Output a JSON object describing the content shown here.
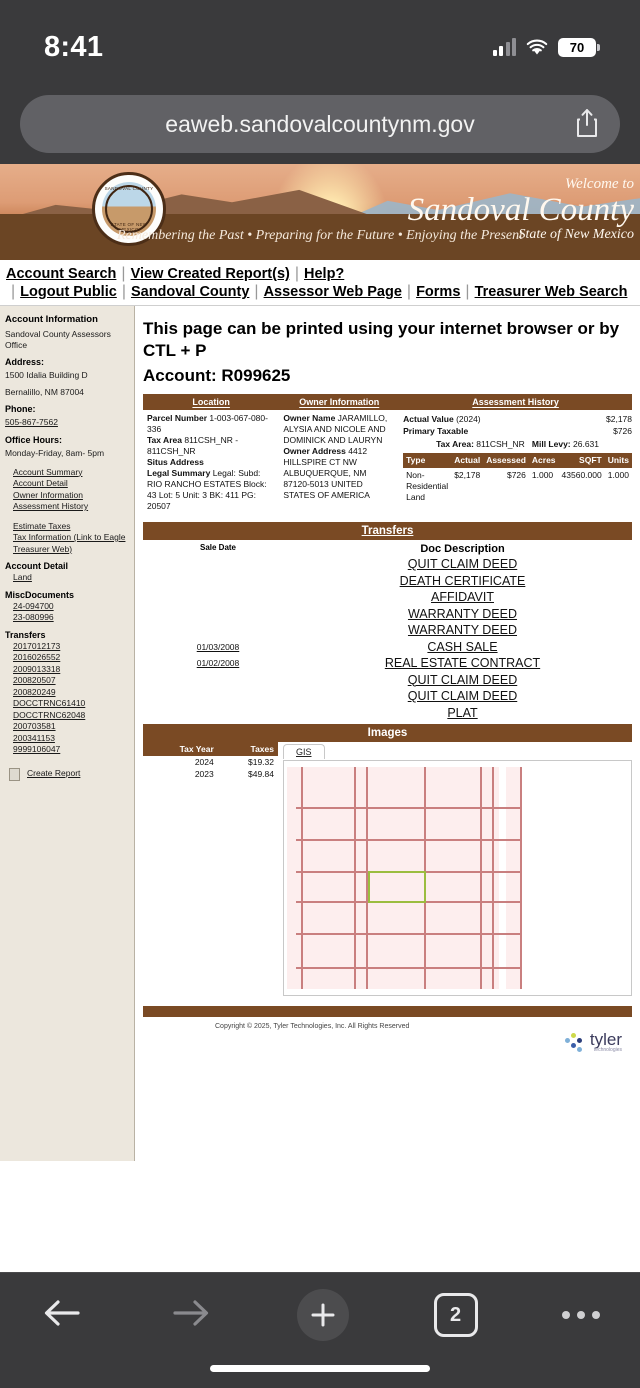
{
  "status_bar": {
    "time": "8:41",
    "battery": "70",
    "cell_icon": "cellular-signal-icon",
    "wifi_icon": "wifi-icon"
  },
  "browser": {
    "url": "eaweb.sandovalcountynm.gov",
    "share_icon": "share-icon",
    "back_icon": "back-arrow-icon",
    "forward_icon": "forward-arrow-icon",
    "new_tab_icon": "plus-icon",
    "tab_count": "2",
    "more_icon": "more-options-icon"
  },
  "banner": {
    "welcome": "Welcome to",
    "county": "Sandoval County",
    "state": "State of New Mexico",
    "motto": "Remembering the Past • Preparing for the Future • Enjoying the Present",
    "seal_top": "SANDOVAL COUNTY",
    "seal_bottom": "STATE OF NEW MEXICO"
  },
  "nav": [
    "Account Search",
    "View Created Report(s)",
    "Help?",
    "Logout Public",
    "Sandoval County",
    "Assessor Web Page",
    "Forms",
    "Treasurer Web Search"
  ],
  "sidebar": {
    "title": "Account Information",
    "office": "Sandoval County Assessors Office",
    "address_label": "Address:",
    "address_line1": "1500 Idalia Building D",
    "address_line2": "Bernalillo, NM 87004",
    "phone_label": "Phone:",
    "phone": "505-867-7562",
    "hours_label": "Office Hours:",
    "hours": "Monday-Friday, 8am- 5pm",
    "links": [
      "Account Summary",
      "Account Detail",
      "Owner Information",
      "Assessment History"
    ],
    "links2": [
      "Estimate Taxes",
      "Tax Information (Link to Eagle Treasurer Web)"
    ],
    "groups": [
      {
        "heading": "Account Detail",
        "items": [
          "Land"
        ]
      },
      {
        "heading": "MiscDocuments",
        "items": [
          "24-094700",
          "23-080996"
        ]
      },
      {
        "heading": "Transfers",
        "items": [
          "2017012173",
          "2016026552",
          "2009013318",
          "200820507",
          "200820249",
          "DOCCTRNC61410",
          "DOCCTRNC62048",
          "200703581",
          "200341153",
          "9999106047"
        ]
      }
    ],
    "create_report": "Create Report"
  },
  "main": {
    "print_notice": "This page can be printed using your internet browser or by CTL + P",
    "account_label": "Account: R099625",
    "columns": {
      "location": "Location",
      "owner": "Owner Information",
      "assessment": "Assessment History"
    },
    "location": {
      "parcel_number_label": "Parcel Number",
      "parcel_number": "1-003-067-080-336",
      "tax_area_label": "Tax Area",
      "tax_area": "811CSH_NR - 811CSH_NR",
      "situs_label": "Situs Address",
      "situs": "",
      "legal_label": "Legal Summary",
      "legal": "Legal: Subd: RIO RANCHO ESTATES Block: 43 Lot: 5 Unit: 3 BK: 411 PG: 20507"
    },
    "owner": {
      "name_label": "Owner Name",
      "name": "JARAMILLO, ALYSIA AND NICOLE AND DOMINICK AND LAURYN",
      "address_label": "Owner Address",
      "address": "4412 HILLSPIRE CT NW ALBUQUERQUE, NM 87120-5013 UNITED STATES OF AMERICA"
    },
    "assessment": {
      "actual_value_label": "Actual Value",
      "actual_value_year": "(2024)",
      "actual_value": "$2,178",
      "primary_taxable_label": "Primary Taxable",
      "primary_taxable": "$726",
      "tax_area_label": "Tax Area:",
      "tax_area": "811CSH_NR",
      "mill_levy_label": "Mill Levy:",
      "mill_levy": "26.631",
      "table_headers": [
        "Type",
        "Actual",
        "Assessed",
        "Acres",
        "SQFT",
        "Units"
      ],
      "rows": [
        {
          "type": "Non-Residential Land",
          "actual": "$2,178",
          "assessed": "$726",
          "acres": "1.000",
          "sqft": "43560.000",
          "units": "1.000"
        }
      ]
    },
    "transfers": {
      "section_title": "Transfers",
      "col_date": "Sale Date",
      "col_doc": "Doc Description",
      "rows": [
        {
          "date": "",
          "doc": "QUIT CLAIM DEED"
        },
        {
          "date": "",
          "doc": "DEATH CERTIFICATE"
        },
        {
          "date": "",
          "doc": "AFFIDAVIT"
        },
        {
          "date": "",
          "doc": "WARRANTY DEED"
        },
        {
          "date": "",
          "doc": "WARRANTY DEED"
        },
        {
          "date": "01/03/2008",
          "doc": "CASH SALE"
        },
        {
          "date": "01/02/2008",
          "doc": "REAL ESTATE CONTRACT"
        },
        {
          "date": "",
          "doc": "QUIT CLAIM DEED"
        },
        {
          "date": "",
          "doc": "QUIT CLAIM DEED"
        },
        {
          "date": "",
          "doc": "PLAT"
        }
      ]
    },
    "images": {
      "section_title": "Images",
      "tax_headers": [
        "Tax Year",
        "Taxes"
      ],
      "tax_rows": [
        {
          "year": "2024",
          "tax": "$19.32"
        },
        {
          "year": "2023",
          "tax": "$49.84"
        }
      ],
      "gis_tab": "GIS"
    },
    "footer": {
      "copyright": "Copyright © 2025, Tyler Technologies, Inc. All Rights Reserved",
      "logo_word": "tyler",
      "logo_sub": "technologies"
    }
  },
  "colors": {
    "brown": "#7a4a24",
    "sidebar_bg": "#ece7dd",
    "chrome_bg": "#3a3a3c",
    "parcel_line": "#c97f7f",
    "selected_parcel": "#9bbd3f"
  }
}
